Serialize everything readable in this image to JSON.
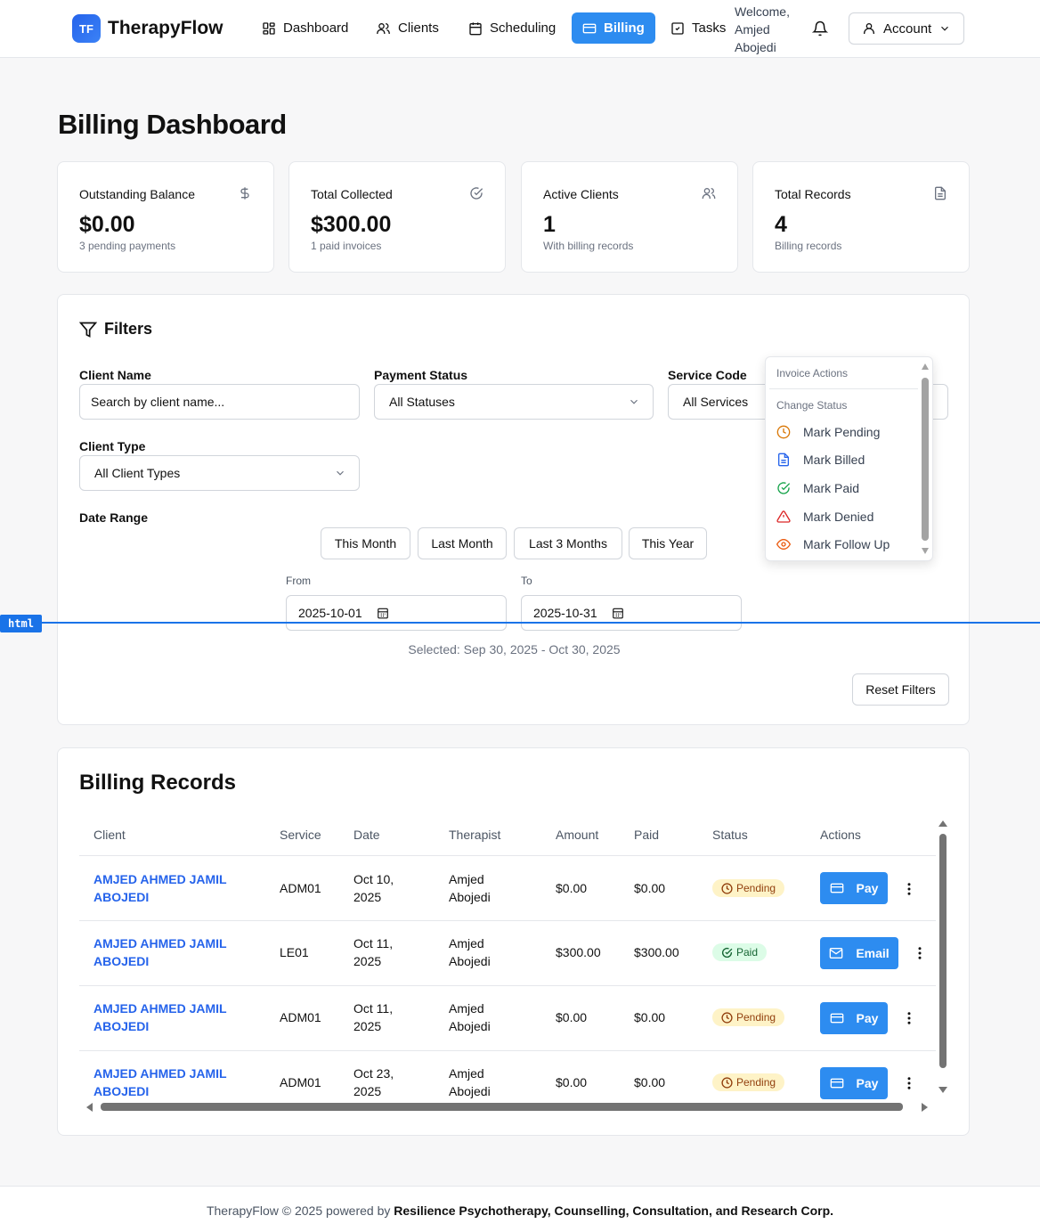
{
  "app": {
    "logo_text": "TF",
    "name": "TherapyFlow"
  },
  "nav": {
    "items": [
      {
        "label": "Dashboard",
        "icon": "dashboard-icon"
      },
      {
        "label": "Clients",
        "icon": "users-icon"
      },
      {
        "label": "Scheduling",
        "icon": "calendar-icon"
      },
      {
        "label": "Billing",
        "icon": "credit-card-icon",
        "active": true
      },
      {
        "label": "Tasks",
        "icon": "check-square-icon"
      }
    ],
    "welcome": "Welcome, Amjed Abojedi",
    "account_label": "Account"
  },
  "page_title": "Billing Dashboard",
  "stats": [
    {
      "label": "Outstanding Balance",
      "value": "$0.00",
      "sub": "3 pending payments",
      "icon": "dollar-icon"
    },
    {
      "label": "Total Collected",
      "value": "$300.00",
      "sub": "1 paid invoices",
      "icon": "check-circle-icon"
    },
    {
      "label": "Active Clients",
      "value": "1",
      "sub": "With billing records",
      "icon": "users-icon"
    },
    {
      "label": "Total Records",
      "value": "4",
      "sub": "Billing records",
      "icon": "file-icon"
    }
  ],
  "filters": {
    "title": "Filters",
    "client_name_label": "Client Name",
    "client_name_placeholder": "Search by client name...",
    "payment_status_label": "Payment Status",
    "payment_status_value": "All Statuses",
    "service_code_label": "Service Code",
    "service_code_value": "All Services",
    "client_type_label": "Client Type",
    "client_type_value": "All Client Types",
    "date_range_label": "Date Range",
    "quick_ranges": [
      "This Month",
      "Last Month",
      "Last 3 Months",
      "This Year"
    ],
    "from_label": "From",
    "from_value": "2025-10-01",
    "to_label": "To",
    "to_value": "2025-10-31",
    "selected_text": "Selected: Sep 30, 2025 - Oct 30, 2025",
    "reset_label": "Reset Filters"
  },
  "invoice_menu": {
    "header": "Invoice Actions",
    "section": "Change Status",
    "items": [
      {
        "label": "Mark Pending",
        "icon": "clock-icon",
        "color": "#d97706"
      },
      {
        "label": "Mark Billed",
        "icon": "file-icon",
        "color": "#2563eb"
      },
      {
        "label": "Mark Paid",
        "icon": "check-circle-icon",
        "color": "#16a34a"
      },
      {
        "label": "Mark Denied",
        "icon": "alert-triangle-icon",
        "color": "#dc2626"
      },
      {
        "label": "Mark Follow Up",
        "icon": "eye-icon",
        "color": "#ea580c"
      }
    ]
  },
  "overlay_tag": "html",
  "records": {
    "title": "Billing Records",
    "columns": [
      "Client",
      "Service",
      "Date",
      "Therapist",
      "Amount",
      "Paid",
      "Status",
      "Actions"
    ],
    "rows": [
      {
        "client": "AMJED AHMED JAMIL ABOJEDI",
        "service": "ADM01",
        "date": "Oct 10, 2025",
        "therapist": "Amjed Abojedi",
        "amount": "$0.00",
        "paid": "$0.00",
        "status": "Pending",
        "action": "Pay"
      },
      {
        "client": "AMJED AHMED JAMIL ABOJEDI",
        "service": "LE01",
        "date": "Oct 11, 2025",
        "therapist": "Amjed Abojedi",
        "amount": "$300.00",
        "paid": "$300.00",
        "status": "Paid",
        "action": "Email"
      },
      {
        "client": "AMJED AHMED JAMIL ABOJEDI",
        "service": "ADM01",
        "date": "Oct 11, 2025",
        "therapist": "Amjed Abojedi",
        "amount": "$0.00",
        "paid": "$0.00",
        "status": "Pending",
        "action": "Pay"
      },
      {
        "client": "AMJED AHMED JAMIL ABOJEDI",
        "service": "ADM01",
        "date": "Oct 23, 2025",
        "therapist": "Amjed Abojedi",
        "amount": "$0.00",
        "paid": "$0.00",
        "status": "Pending",
        "action": "Pay"
      }
    ]
  },
  "footer": {
    "prefix": "TherapyFlow © 2025 powered by ",
    "company": "Resilience Psychotherapy, Counselling, Consultation, and Research Corp."
  },
  "colors": {
    "primary": "#2d8cf0",
    "link": "#2563eb",
    "pending_bg": "#fef3c7",
    "paid_bg": "#dcfce7"
  }
}
